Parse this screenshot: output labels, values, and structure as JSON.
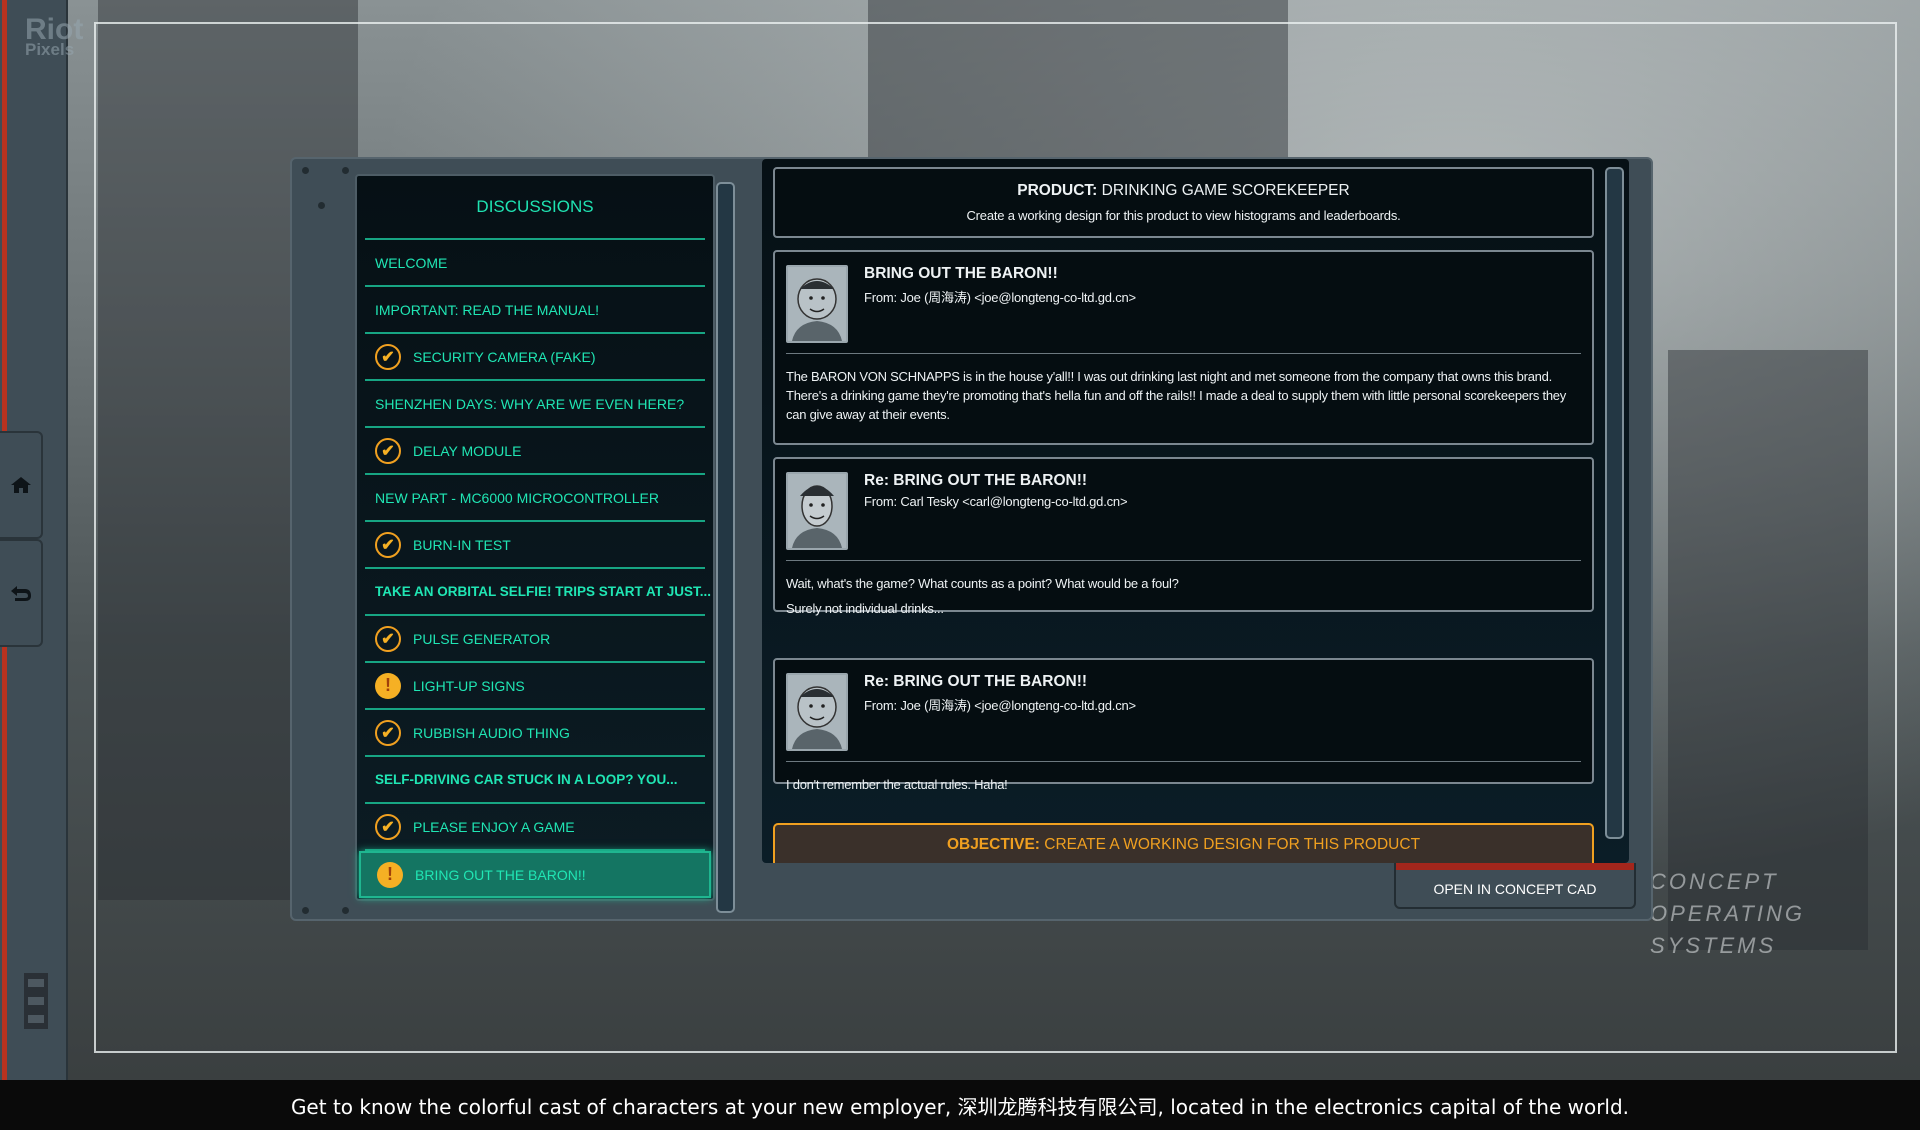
{
  "watermark": {
    "line1": "Riot",
    "line2": "Pixels"
  },
  "sidebar": {
    "home_icon": "home-icon",
    "back_icon": "undo-arrow-icon"
  },
  "discussions": {
    "title": "DISCUSSIONS",
    "items": [
      {
        "label": "WELCOME",
        "status": "none",
        "bold": false
      },
      {
        "label": "IMPORTANT: READ THE MANUAL!",
        "status": "none",
        "bold": false
      },
      {
        "label": "SECURITY CAMERA (FAKE)",
        "status": "complete",
        "bold": false
      },
      {
        "label": "SHENZHEN DAYS: WHY ARE WE EVEN HERE?",
        "status": "none",
        "bold": false
      },
      {
        "label": "DELAY MODULE",
        "status": "complete",
        "bold": false
      },
      {
        "label": "NEW PART - MC6000 MICROCONTROLLER",
        "status": "none",
        "bold": false
      },
      {
        "label": "BURN-IN TEST",
        "status": "complete",
        "bold": false
      },
      {
        "label": "TAKE AN ORBITAL SELFIE! TRIPS START AT JUST...",
        "status": "none",
        "bold": true
      },
      {
        "label": "PULSE GENERATOR",
        "status": "complete",
        "bold": false
      },
      {
        "label": "LIGHT-UP SIGNS",
        "status": "pending",
        "bold": false
      },
      {
        "label": "RUBBISH AUDIO THING",
        "status": "complete",
        "bold": false
      },
      {
        "label": "SELF-DRIVING CAR STUCK IN A LOOP? YOU...",
        "status": "none",
        "bold": true
      },
      {
        "label": "PLEASE ENJOY A GAME",
        "status": "complete",
        "bold": false
      },
      {
        "label": "BRING OUT THE BARON!!",
        "status": "pending",
        "bold": false,
        "selected": true
      }
    ]
  },
  "product": {
    "label": "PRODUCT:",
    "name": "DRINKING GAME SCOREKEEPER",
    "description": "Create a working design for this product to view histograms and leaderboards."
  },
  "emails": [
    {
      "subject": "BRING OUT THE BARON!!",
      "from": "From: Joe (周海涛) <joe@longteng-co-ltd.gd.cn>",
      "body": [
        "The BARON VON SCHNAPPS is in the house y'all!! I was out drinking last night and met someone from the company that owns this brand. There's a drinking game they're promoting that's hella fun and off the rails!! I made a deal to supply them with little personal scorekeepers they can give away at their events."
      ]
    },
    {
      "subject": "Re: BRING OUT THE BARON!!",
      "from": "From: Carl Tesky <carl@longteng-co-ltd.gd.cn>",
      "body": [
        "Wait, what's the game? What counts as a point? What would be a foul?",
        "Surely not individual drinks..."
      ]
    },
    {
      "subject": "Re: BRING OUT THE BARON!!",
      "from": "From: Joe (周海涛) <joe@longteng-co-ltd.gd.cn>",
      "body": [
        "I don't remember the actual rules. Haha!"
      ]
    }
  ],
  "objective": {
    "label": "OBJECTIVE:",
    "text": "CREATE A WORKING DESIGN FOR THIS PRODUCT"
  },
  "open_cad_button": "OPEN IN CONCEPT CAD",
  "background_sign": {
    "line1": "CONCEPT",
    "line2": "OPERATING",
    "line3": "SYSTEMS"
  },
  "caption": "Get to know the colorful cast of characters at your new employer, 深圳龙腾科技有限公司, located in the electronics capital of the world.",
  "colors": {
    "accent": "#20e6b4",
    "warning": "#f5b024",
    "objective": "#f0a020",
    "panel": "#3f4d56",
    "button_bar": "#a3261c"
  }
}
